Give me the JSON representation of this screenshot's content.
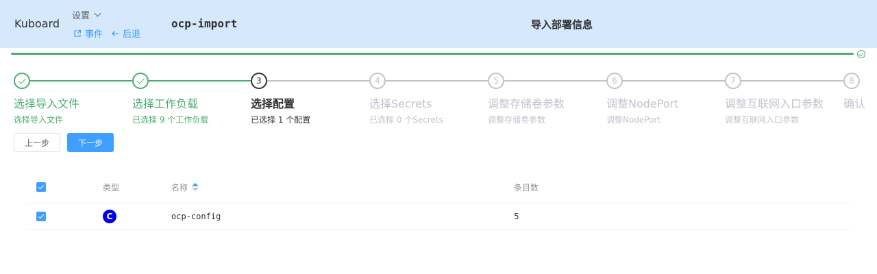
{
  "colors": {
    "accent": "#409eff",
    "success": "#4cad72",
    "header_bg": "#d6e9fc",
    "config_badge": "#0000e6"
  },
  "header": {
    "brand": "Kuboard",
    "settings_label": "设置",
    "events_label": "事件",
    "back_label": "后退",
    "app_name": "ocp-import",
    "title": "导入部署信息"
  },
  "progress": {
    "percent": 100
  },
  "steps": [
    {
      "num": "1",
      "title": "选择导入文件",
      "desc": "选择导入文件",
      "status": "done"
    },
    {
      "num": "2",
      "title": "选择工作负载",
      "desc": "已选择 9 个工作负载",
      "status": "done"
    },
    {
      "num": "3",
      "title": "选择配置",
      "desc": "已选择 1 个配置",
      "status": "active"
    },
    {
      "num": "4",
      "title": "选择Secrets",
      "desc": "已选择 0 个Secrets",
      "status": "wait"
    },
    {
      "num": "5",
      "title": "调整存储卷参数",
      "desc": "调整存储卷参数",
      "status": "wait"
    },
    {
      "num": "6",
      "title": "调整NodePort",
      "desc": "调整NodePort",
      "status": "wait"
    },
    {
      "num": "7",
      "title": "调整互联网入口参数",
      "desc": "调整互联网入口参数",
      "status": "wait"
    },
    {
      "num": "8",
      "title": "确认",
      "desc": "",
      "status": "wait"
    }
  ],
  "buttons": {
    "prev": "上一步",
    "next": "下一步"
  },
  "table": {
    "columns": {
      "type": "类型",
      "name": "名称",
      "count": "条目数"
    },
    "rows": [
      {
        "checked": true,
        "type_badge": "C",
        "name": "ocp-config",
        "count": "5"
      }
    ]
  }
}
